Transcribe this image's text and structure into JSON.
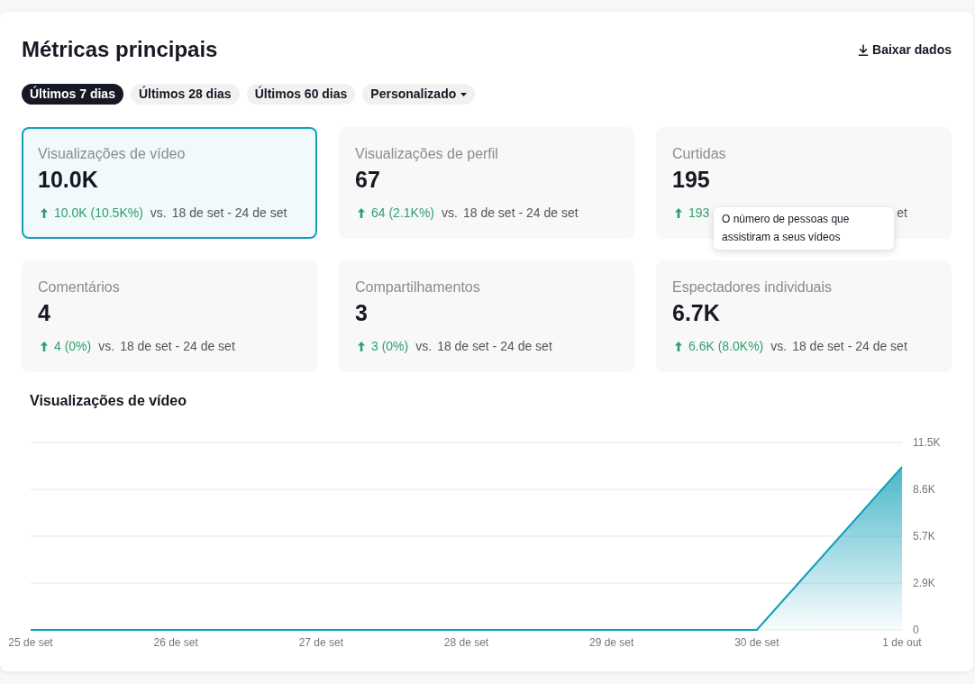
{
  "header": {
    "title": "Métricas principais",
    "download": "Baixar dados"
  },
  "ranges": [
    {
      "label": "Últimos 7 dias",
      "kind": "pill",
      "selected": true
    },
    {
      "label": "Últimos 28 dias",
      "kind": "pill",
      "selected": false
    },
    {
      "label": "Últimos 60 dias",
      "kind": "pill",
      "selected": false
    },
    {
      "label": "Personalizado",
      "kind": "dropdown",
      "selected": false
    }
  ],
  "metrics": [
    {
      "label": "Visualizações de vídeo",
      "value": "10.0K",
      "selected": true,
      "increase": true,
      "change": "10.0K (10.5K%)",
      "vs": "vs.",
      "period": "18 de set - 24 de set"
    },
    {
      "label": "Visualizações de perfil",
      "value": "67",
      "selected": false,
      "increase": true,
      "change": "64 (2.1K%)",
      "vs": "vs.",
      "period": "18 de set - 24 de set"
    },
    {
      "label": "Curtidas",
      "value": "195",
      "selected": false,
      "increase": true,
      "change": "193",
      "period": "et"
    },
    {
      "label": "Comentários",
      "value": "4",
      "selected": false,
      "increase": true,
      "change": "4 (0%)",
      "vs": "vs.",
      "period": "18 de set - 24 de set"
    },
    {
      "label": "Compartilhamentos",
      "value": "3",
      "selected": false,
      "increase": true,
      "change": "3 (0%)",
      "vs": "vs.",
      "period": "18 de set - 24 de set"
    },
    {
      "label": "Espectadores individuais",
      "value": "6.7K",
      "selected": false,
      "increase": true,
      "change": "6.6K (8.0K%)",
      "vs": "vs.",
      "period": "18 de set - 24 de set",
      "tooltip": "O número de pessoas que assistiram a seus vídeos"
    }
  ],
  "chart": {
    "chart_data": {
      "type": "area",
      "title": "Visualizações de vídeo",
      "categories": [
        "25 de set",
        "26 de set",
        "27 de set",
        "28 de set",
        "29 de set",
        "30 de set",
        "1 de out"
      ],
      "series": [
        {
          "color": "#0e9fb8",
          "values": [
            0,
            0,
            0,
            0,
            0,
            0,
            10000
          ]
        }
      ],
      "ylim": [
        0,
        11500
      ],
      "yticks": [
        0,
        {
          "value": 2875,
          "label": "2.9K"
        },
        {
          "value": 5750,
          "label": "5.7K"
        },
        {
          "value": 8625,
          "label": "8.6K"
        },
        {
          "value": 11500,
          "label": "11.5K"
        }
      ],
      "grid": true
    }
  }
}
